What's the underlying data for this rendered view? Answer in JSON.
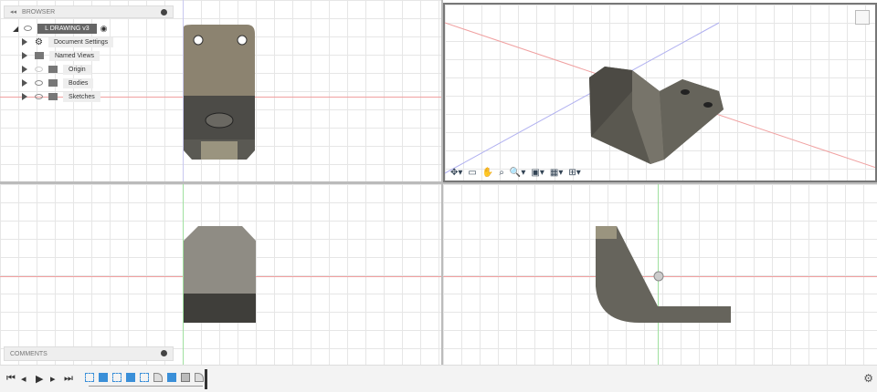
{
  "browser": {
    "title": "BROWSER",
    "root": "L DRAWING v3",
    "items": [
      {
        "label": "Document Settings",
        "icon": "gear-icon"
      },
      {
        "label": "Named Views",
        "icon": "folder-icon"
      },
      {
        "label": "Origin",
        "icon": "folder-icon"
      },
      {
        "label": "Bodies",
        "icon": "folder-icon"
      },
      {
        "label": "Sketches",
        "icon": "folder-icon"
      }
    ]
  },
  "comments": {
    "title": "COMMENTS"
  },
  "navbar": {
    "icons": [
      "orbit-icon",
      "look-at-icon",
      "pan-icon",
      "zoom-window-icon",
      "zoom-icon",
      "display-settings-icon",
      "grid-settings-icon",
      "viewports-icon"
    ]
  },
  "timeline": {
    "controls": [
      "⏮",
      "◂",
      "▶",
      "▸",
      "⏭"
    ],
    "features": [
      "sketch",
      "extrude",
      "sketch",
      "extrude",
      "sketch",
      "fillet",
      "extrude",
      "hole",
      "fillet"
    ]
  },
  "colors": {
    "body": "#6e6b62",
    "accent": "#3a8fd8"
  }
}
